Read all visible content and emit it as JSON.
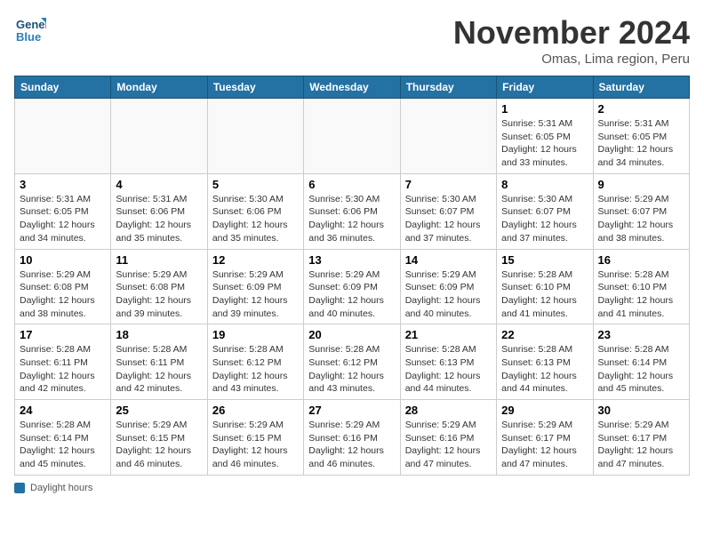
{
  "header": {
    "logo_line1": "General",
    "logo_line2": "Blue",
    "month_title": "November 2024",
    "location": "Omas, Lima region, Peru"
  },
  "weekdays": [
    "Sunday",
    "Monday",
    "Tuesday",
    "Wednesday",
    "Thursday",
    "Friday",
    "Saturday"
  ],
  "weeks": [
    [
      {
        "day": "",
        "info": ""
      },
      {
        "day": "",
        "info": ""
      },
      {
        "day": "",
        "info": ""
      },
      {
        "day": "",
        "info": ""
      },
      {
        "day": "",
        "info": ""
      },
      {
        "day": "1",
        "info": "Sunrise: 5:31 AM\nSunset: 6:05 PM\nDaylight: 12 hours and 33 minutes."
      },
      {
        "day": "2",
        "info": "Sunrise: 5:31 AM\nSunset: 6:05 PM\nDaylight: 12 hours and 34 minutes."
      }
    ],
    [
      {
        "day": "3",
        "info": "Sunrise: 5:31 AM\nSunset: 6:05 PM\nDaylight: 12 hours and 34 minutes."
      },
      {
        "day": "4",
        "info": "Sunrise: 5:31 AM\nSunset: 6:06 PM\nDaylight: 12 hours and 35 minutes."
      },
      {
        "day": "5",
        "info": "Sunrise: 5:30 AM\nSunset: 6:06 PM\nDaylight: 12 hours and 35 minutes."
      },
      {
        "day": "6",
        "info": "Sunrise: 5:30 AM\nSunset: 6:06 PM\nDaylight: 12 hours and 36 minutes."
      },
      {
        "day": "7",
        "info": "Sunrise: 5:30 AM\nSunset: 6:07 PM\nDaylight: 12 hours and 37 minutes."
      },
      {
        "day": "8",
        "info": "Sunrise: 5:30 AM\nSunset: 6:07 PM\nDaylight: 12 hours and 37 minutes."
      },
      {
        "day": "9",
        "info": "Sunrise: 5:29 AM\nSunset: 6:07 PM\nDaylight: 12 hours and 38 minutes."
      }
    ],
    [
      {
        "day": "10",
        "info": "Sunrise: 5:29 AM\nSunset: 6:08 PM\nDaylight: 12 hours and 38 minutes."
      },
      {
        "day": "11",
        "info": "Sunrise: 5:29 AM\nSunset: 6:08 PM\nDaylight: 12 hours and 39 minutes."
      },
      {
        "day": "12",
        "info": "Sunrise: 5:29 AM\nSunset: 6:09 PM\nDaylight: 12 hours and 39 minutes."
      },
      {
        "day": "13",
        "info": "Sunrise: 5:29 AM\nSunset: 6:09 PM\nDaylight: 12 hours and 40 minutes."
      },
      {
        "day": "14",
        "info": "Sunrise: 5:29 AM\nSunset: 6:09 PM\nDaylight: 12 hours and 40 minutes."
      },
      {
        "day": "15",
        "info": "Sunrise: 5:28 AM\nSunset: 6:10 PM\nDaylight: 12 hours and 41 minutes."
      },
      {
        "day": "16",
        "info": "Sunrise: 5:28 AM\nSunset: 6:10 PM\nDaylight: 12 hours and 41 minutes."
      }
    ],
    [
      {
        "day": "17",
        "info": "Sunrise: 5:28 AM\nSunset: 6:11 PM\nDaylight: 12 hours and 42 minutes."
      },
      {
        "day": "18",
        "info": "Sunrise: 5:28 AM\nSunset: 6:11 PM\nDaylight: 12 hours and 42 minutes."
      },
      {
        "day": "19",
        "info": "Sunrise: 5:28 AM\nSunset: 6:12 PM\nDaylight: 12 hours and 43 minutes."
      },
      {
        "day": "20",
        "info": "Sunrise: 5:28 AM\nSunset: 6:12 PM\nDaylight: 12 hours and 43 minutes."
      },
      {
        "day": "21",
        "info": "Sunrise: 5:28 AM\nSunset: 6:13 PM\nDaylight: 12 hours and 44 minutes."
      },
      {
        "day": "22",
        "info": "Sunrise: 5:28 AM\nSunset: 6:13 PM\nDaylight: 12 hours and 44 minutes."
      },
      {
        "day": "23",
        "info": "Sunrise: 5:28 AM\nSunset: 6:14 PM\nDaylight: 12 hours and 45 minutes."
      }
    ],
    [
      {
        "day": "24",
        "info": "Sunrise: 5:28 AM\nSunset: 6:14 PM\nDaylight: 12 hours and 45 minutes."
      },
      {
        "day": "25",
        "info": "Sunrise: 5:29 AM\nSunset: 6:15 PM\nDaylight: 12 hours and 46 minutes."
      },
      {
        "day": "26",
        "info": "Sunrise: 5:29 AM\nSunset: 6:15 PM\nDaylight: 12 hours and 46 minutes."
      },
      {
        "day": "27",
        "info": "Sunrise: 5:29 AM\nSunset: 6:16 PM\nDaylight: 12 hours and 46 minutes."
      },
      {
        "day": "28",
        "info": "Sunrise: 5:29 AM\nSunset: 6:16 PM\nDaylight: 12 hours and 47 minutes."
      },
      {
        "day": "29",
        "info": "Sunrise: 5:29 AM\nSunset: 6:17 PM\nDaylight: 12 hours and 47 minutes."
      },
      {
        "day": "30",
        "info": "Sunrise: 5:29 AM\nSunset: 6:17 PM\nDaylight: 12 hours and 47 minutes."
      }
    ]
  ],
  "footer": {
    "label": "Daylight hours"
  }
}
